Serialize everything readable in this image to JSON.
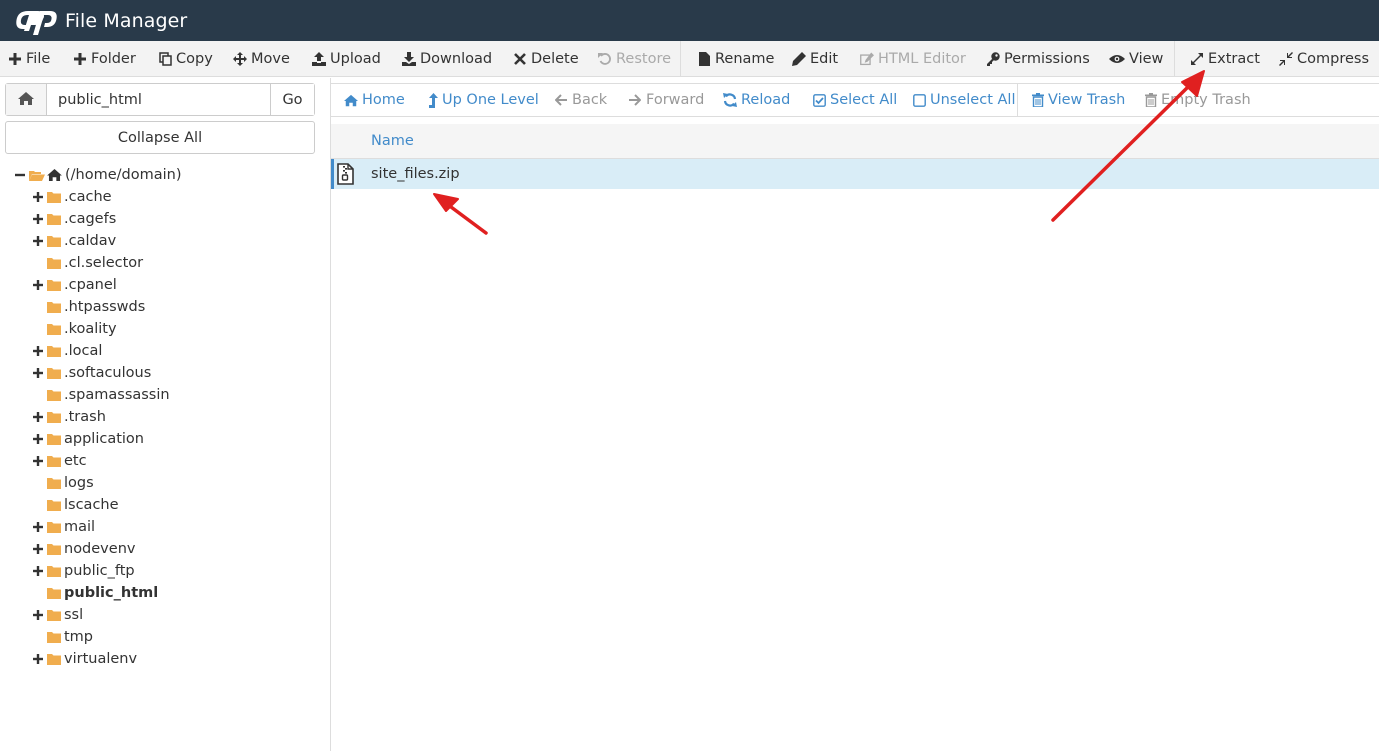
{
  "header": {
    "app_title": "File Manager",
    "logo_icon": "cpanel-logo-icon"
  },
  "toolbar": {
    "items": [
      {
        "label": "File",
        "icon": "plus-icon"
      },
      {
        "label": "Folder",
        "icon": "plus-icon"
      },
      {
        "label": "Copy",
        "icon": "copy-icon"
      },
      {
        "label": "Move",
        "icon": "move-icon"
      },
      {
        "label": "Upload",
        "icon": "upload-icon"
      },
      {
        "label": "Download",
        "icon": "download-icon"
      },
      {
        "label": "Delete",
        "icon": "close-icon"
      },
      {
        "label": "Restore",
        "icon": "undo-icon",
        "disabled": true
      },
      {
        "label": "Rename",
        "icon": "file-icon"
      },
      {
        "label": "Edit",
        "icon": "pencil-icon"
      },
      {
        "label": "HTML Editor",
        "icon": "edit-icon",
        "disabled": true
      },
      {
        "label": "Permissions",
        "icon": "key-icon"
      },
      {
        "label": "View",
        "icon": "eye-icon"
      },
      {
        "label": "Extract",
        "icon": "expand-icon"
      },
      {
        "label": "Compress",
        "icon": "compress-icon"
      }
    ]
  },
  "path": {
    "value": "public_html",
    "go_label": "Go"
  },
  "sidebar": {
    "collapse_label": "Collapse All",
    "tree": [
      {
        "label": "(/home/domain)",
        "expander": "minus"
      },
      {
        "label": ".cache",
        "expander": "plus"
      },
      {
        "label": ".cagefs",
        "expander": "plus"
      },
      {
        "label": ".caldav",
        "expander": "plus"
      },
      {
        "label": ".cl.selector",
        "expander": "none"
      },
      {
        "label": ".cpanel",
        "expander": "plus"
      },
      {
        "label": ".htpasswds",
        "expander": "none"
      },
      {
        "label": ".koality",
        "expander": "none"
      },
      {
        "label": ".local",
        "expander": "plus"
      },
      {
        "label": ".softaculous",
        "expander": "plus"
      },
      {
        "label": ".spamassassin",
        "expander": "none"
      },
      {
        "label": ".trash",
        "expander": "plus"
      },
      {
        "label": "application",
        "expander": "plus"
      },
      {
        "label": "etc",
        "expander": "plus"
      },
      {
        "label": "logs",
        "expander": "none"
      },
      {
        "label": "lscache",
        "expander": "none"
      },
      {
        "label": "mail",
        "expander": "plus"
      },
      {
        "label": "nodevenv",
        "expander": "plus"
      },
      {
        "label": "public_ftp",
        "expander": "plus"
      },
      {
        "label": "public_html",
        "expander": "none",
        "selected": true
      },
      {
        "label": "ssl",
        "expander": "plus"
      },
      {
        "label": "tmp",
        "expander": "none"
      },
      {
        "label": "virtualenv",
        "expander": "plus"
      }
    ]
  },
  "nav": {
    "items": [
      {
        "label": "Home",
        "icon": "home-icon"
      },
      {
        "label": "Up One Level",
        "icon": "level-up-icon"
      },
      {
        "label": "Back",
        "icon": "arrow-left-icon",
        "disabled": true
      },
      {
        "label": "Forward",
        "icon": "arrow-right-icon",
        "disabled": true
      },
      {
        "label": "Reload",
        "icon": "refresh-icon"
      },
      {
        "label": "Select All",
        "icon": "checkbox-checked-icon"
      },
      {
        "label": "Unselect All",
        "icon": "checkbox-empty-icon"
      },
      {
        "label": "View Trash",
        "icon": "trash-icon"
      },
      {
        "label": "Empty Trash",
        "icon": "trash-icon",
        "disabled": true
      }
    ]
  },
  "table": {
    "column_name": "Name",
    "files": [
      {
        "name": "site_files.zip",
        "icon": "zip-file-icon",
        "selected": true
      }
    ]
  },
  "colors": {
    "header_bg": "#293a4a",
    "link_blue": "#428bca",
    "selected_row": "#d9edf7",
    "folder": "#f0ad4e",
    "annotation_arrow": "#e02020"
  }
}
